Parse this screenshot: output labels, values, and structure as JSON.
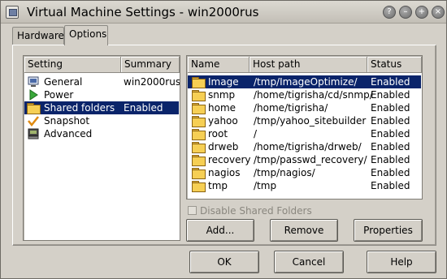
{
  "window": {
    "title": "Virtual Machine Settings - win2000rus",
    "title_buttons": [
      "help-icon",
      "minimize-icon",
      "maximize-icon",
      "close-icon"
    ]
  },
  "tabs": [
    {
      "label": "Hardware"
    },
    {
      "label": "Options"
    }
  ],
  "settings_list": {
    "headers": {
      "setting": "Setting",
      "summary": "Summary"
    },
    "items": [
      {
        "label": "General",
        "summary": "win2000rus",
        "icon": "monitor-icon"
      },
      {
        "label": "Power",
        "summary": "",
        "icon": "play-icon"
      },
      {
        "label": "Shared folders",
        "summary": "Enabled",
        "icon": "folder-icon",
        "selected": true
      },
      {
        "label": "Snapshot",
        "summary": "",
        "icon": "snapshot-icon"
      },
      {
        "label": "Advanced",
        "summary": "",
        "icon": "computer-icon"
      }
    ]
  },
  "folders_table": {
    "headers": {
      "name": "Name",
      "host_path": "Host path",
      "status": "Status"
    },
    "rows": [
      {
        "name": "Image",
        "host_path": "/tmp/ImageOptimize/",
        "status": "Enabled",
        "selected": true
      },
      {
        "name": "snmp",
        "host_path": "/home/tigrisha/cd/snmp/",
        "status": "Enabled"
      },
      {
        "name": "home",
        "host_path": "/home/tigrisha/",
        "status": "Enabled"
      },
      {
        "name": "yahoo",
        "host_path": "/tmp/yahoo_sitebuilder",
        "status": "Enabled"
      },
      {
        "name": "root",
        "host_path": "/",
        "status": "Enabled"
      },
      {
        "name": "drweb",
        "host_path": "/home/tigrisha/drweb/",
        "status": "Enabled"
      },
      {
        "name": "recovery",
        "host_path": "/tmp/passwd_recovery/",
        "status": "Enabled"
      },
      {
        "name": "nagios",
        "host_path": "/tmp/nagios/",
        "status": "Enabled"
      },
      {
        "name": "tmp",
        "host_path": "/tmp",
        "status": "Enabled"
      }
    ]
  },
  "disable_checkbox": {
    "label": "Disable Shared Folders",
    "checked": false,
    "enabled": false
  },
  "folder_buttons": {
    "add": "Add...",
    "remove": "Remove",
    "properties": "Properties"
  },
  "dialog_buttons": {
    "ok": "OK",
    "cancel": "Cancel",
    "help": "Help"
  },
  "colors": {
    "selection": "#0a246a",
    "window_bg": "#d4d0c8",
    "folder": "#f6cf54"
  }
}
